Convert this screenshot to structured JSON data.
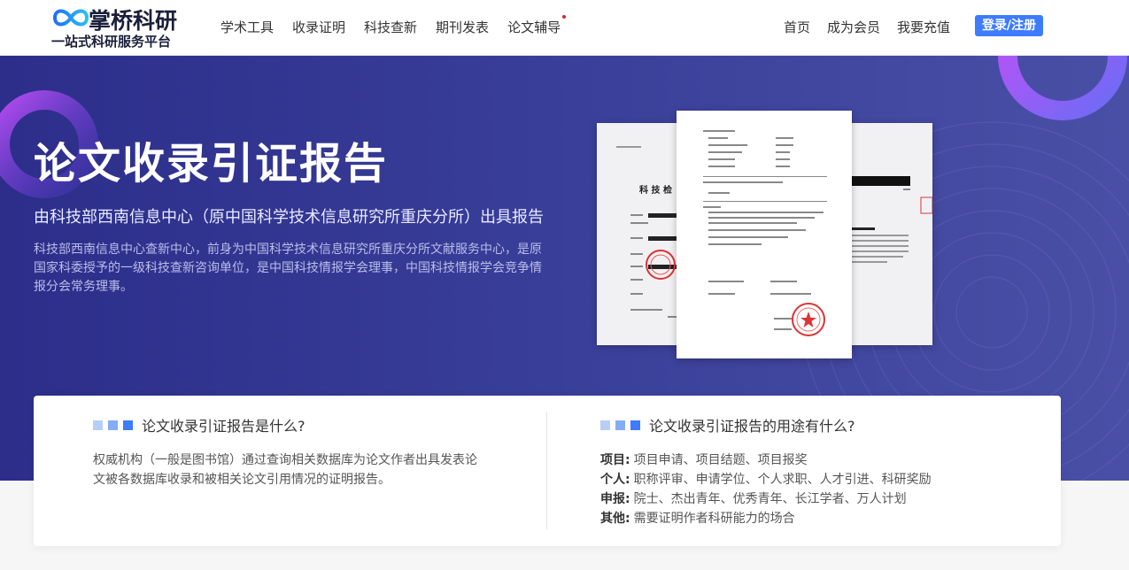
{
  "brand": {
    "name": "掌桥科研",
    "slogan": "一站式科研服务平台",
    "accent": "#3d7bff"
  },
  "nav": {
    "items": [
      {
        "label": "学术工具"
      },
      {
        "label": "收录证明"
      },
      {
        "label": "科技查新"
      },
      {
        "label": "期刊发表"
      },
      {
        "label": "论文辅导"
      }
    ],
    "right_items": [
      {
        "label": "首页"
      },
      {
        "label": "成为会员"
      },
      {
        "label": "我要充值"
      }
    ],
    "login_label": "登录/注册"
  },
  "hero": {
    "title": "论文收录引证报告",
    "subtitle": "由科技部西南信息中心（原中国科学技术信息研究所重庆分所）出具报告",
    "description": "科技部西南信息中心查新中心，前身为中国科学技术信息研究所重庆分所文献服务中心，是原国家科委授予的一级科技查新咨询单位，是中国科技情报学会理事，中国科技情报学会竞争情报分会常务理事。",
    "doc_heading": "科 技 检"
  },
  "info": {
    "what": {
      "title": "论文收录引证报告是什么?",
      "body": "权威机构（一般是图书馆）通过查询相关数据库为论文作者出具发表论文被各数据库收录和被相关论文引用情况的证明报告。"
    },
    "uses": {
      "title": "论文收录引证报告的用途有什么?",
      "rows": [
        {
          "key": "项目:",
          "value": "项目申请、项目结题、项目报奖"
        },
        {
          "key": "个人:",
          "value": "职称评审、申请学位、个人求职、人才引进、科研奖励"
        },
        {
          "key": "申报:",
          "value": "院士、杰出青年、优秀青年、长江学者、万人计划"
        },
        {
          "key": "其他:",
          "value": "需要证明作者科研能力的场合"
        }
      ]
    }
  }
}
